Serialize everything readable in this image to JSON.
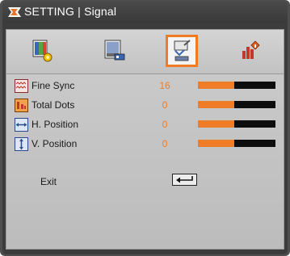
{
  "window": {
    "title": "SETTING | Signal"
  },
  "tabs": [
    {
      "icon": "image-settings-icon",
      "active": false
    },
    {
      "icon": "display-settings-icon",
      "active": false
    },
    {
      "icon": "setup-signal-icon",
      "active": true
    },
    {
      "icon": "options-icon",
      "active": false
    }
  ],
  "items": [
    {
      "label": "Fine Sync",
      "value": "16",
      "level": 0.47,
      "icon": "fine-sync-icon"
    },
    {
      "label": "Total Dots",
      "value": "0",
      "level": 0.47,
      "icon": "total-dots-icon"
    },
    {
      "label": "H. Position",
      "value": "0",
      "level": 0.47,
      "icon": "h-position-icon"
    },
    {
      "label": "V. Position",
      "value": "0",
      "level": 0.47,
      "icon": "v-position-icon"
    }
  ],
  "exit": {
    "label": "Exit",
    "icon": "enter-key-icon"
  },
  "colors": {
    "accent": "#f07b22",
    "bar_track": "#0d0d0d",
    "panel_bg": "#c4c4c4"
  }
}
